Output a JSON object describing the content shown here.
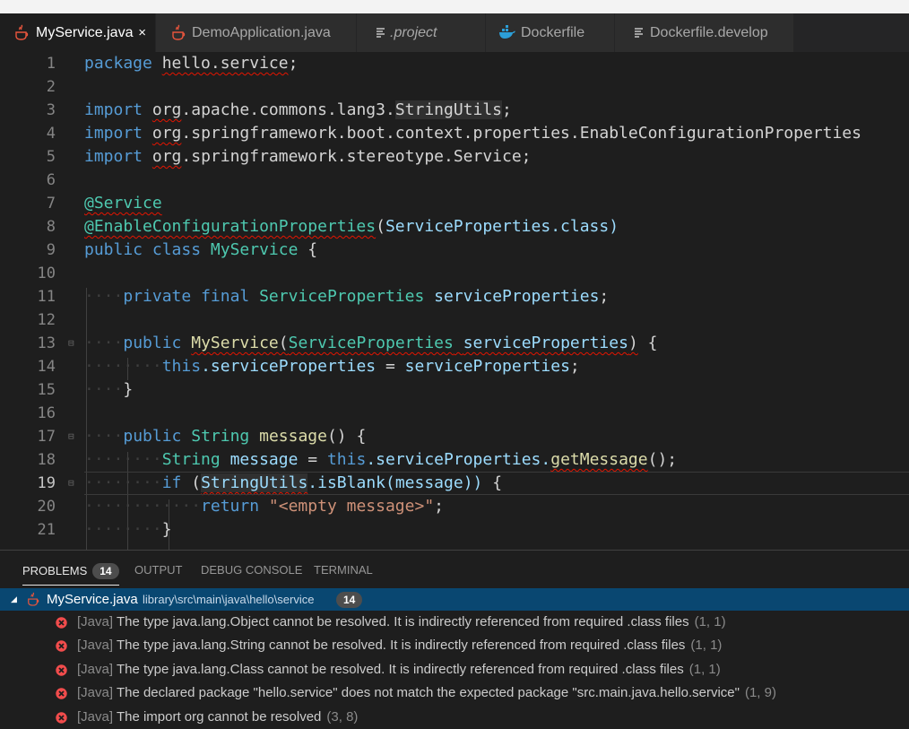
{
  "tabs": [
    {
      "label": "MyService.java",
      "icon": "java-icon"
    },
    {
      "label": "DemoApplication.java",
      "icon": "java-icon"
    },
    {
      "label": ".project",
      "icon": "text-file-icon"
    },
    {
      "label": "Dockerfile",
      "icon": "docker-icon"
    },
    {
      "label": "Dockerfile.develop",
      "icon": "text-file-icon"
    }
  ],
  "close_symbol": "×",
  "line_numbers": [
    "1",
    "2",
    "3",
    "4",
    "5",
    "6",
    "7",
    "8",
    "9",
    "10",
    "11",
    "12",
    "13",
    "14",
    "15",
    "16",
    "17",
    "18",
    "19",
    "20",
    "21"
  ],
  "code": {
    "l1": [
      "package",
      "hello.service",
      ";"
    ],
    "l3": [
      "import",
      "org",
      ".apache.commons.lang3.",
      "StringUtils",
      ";"
    ],
    "l4": [
      "import",
      "org",
      ".springframework.boot.context.properties.EnableConfigurationProperties"
    ],
    "l5": [
      "import",
      "org",
      ".springframework.stereotype.Service;"
    ],
    "l7": [
      "@Service"
    ],
    "l8": [
      "@EnableConfigurationProperties",
      "(",
      "ServiceProperties",
      ".class)"
    ],
    "l9": [
      "public",
      "class",
      "MyService",
      "{"
    ],
    "l11": [
      "private",
      "final",
      "ServiceProperties",
      "serviceProperties",
      ";"
    ],
    "l13": [
      "public",
      "MyService",
      "(",
      "ServiceProperties",
      "serviceProperties",
      ")",
      "{"
    ],
    "l14": [
      "this",
      ".serviceProperties",
      "=",
      "serviceProperties",
      ";"
    ],
    "l15": [
      "}"
    ],
    "l17": [
      "public",
      "String",
      "message",
      "()",
      "{"
    ],
    "l18": [
      "String",
      "message",
      "=",
      "this",
      ".serviceProperties.",
      "getMessage",
      "();"
    ],
    "l19": [
      "if",
      "(",
      "StringUtils",
      ".isBlank(message))",
      "{"
    ],
    "l20": [
      "return",
      "\"<empty message>\"",
      ";"
    ],
    "l21": [
      "}"
    ]
  },
  "panel": {
    "tabs": [
      "PROBLEMS",
      "OUTPUT",
      "DEBUG CONSOLE",
      "TERMINAL"
    ],
    "problem_count": "14",
    "file": {
      "name": "MyService.java",
      "path": "library\\src\\main\\java\\hello\\service",
      "count": "14"
    },
    "problems": [
      {
        "source": "[Java]",
        "message": "The type java.lang.Object cannot be resolved. It is indirectly referenced from required .class files",
        "position": "(1, 1)"
      },
      {
        "source": "[Java]",
        "message": "The type java.lang.String cannot be resolved. It is indirectly referenced from required .class files",
        "position": "(1, 1)"
      },
      {
        "source": "[Java]",
        "message": "The type java.lang.Class cannot be resolved. It is indirectly referenced from required .class files",
        "position": "(1, 1)"
      },
      {
        "source": "[Java]",
        "message": "The declared package \"hello.service\" does not match the expected package \"src.main.java.hello.service\"",
        "position": "(1, 9)"
      },
      {
        "source": "[Java]",
        "message": "The import org cannot be resolved",
        "position": "(3, 8)"
      }
    ]
  },
  "colors": {
    "keyword": "#569cd6",
    "type": "#4ec9b0",
    "function": "#dcdcaa",
    "variable": "#9cdcfe",
    "string": "#ce9178",
    "error": "#f14c4c",
    "selection": "#094771"
  }
}
